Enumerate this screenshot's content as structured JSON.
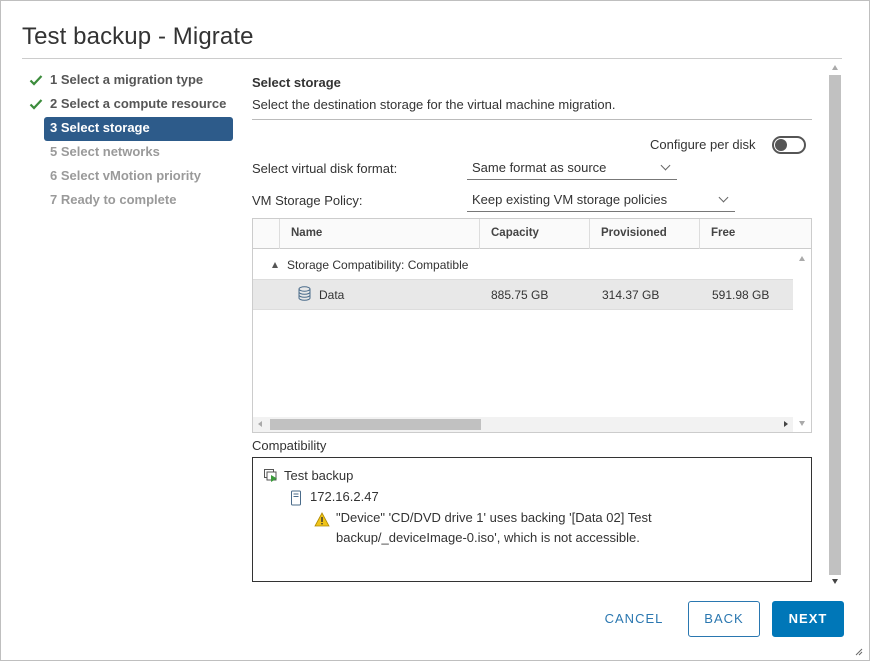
{
  "dialog": {
    "title": "Test backup - Migrate"
  },
  "steps": [
    {
      "label": "1 Select a migration type",
      "state": "done"
    },
    {
      "label": "2 Select a compute resource",
      "state": "done"
    },
    {
      "label": "3 Select storage",
      "state": "active"
    },
    {
      "label": "5 Select networks",
      "state": "disabled"
    },
    {
      "label": "6 Select vMotion priority",
      "state": "disabled"
    },
    {
      "label": "7 Ready to complete",
      "state": "disabled"
    }
  ],
  "section": {
    "title": "Select storage",
    "description": "Select the destination storage for the virtual machine migration."
  },
  "config_per_disk": {
    "label": "Configure per disk",
    "enabled": false
  },
  "disk_format": {
    "label": "Select virtual disk format:",
    "value": "Same format as source"
  },
  "storage_policy": {
    "label": "VM Storage Policy:",
    "value": "Keep existing VM storage policies"
  },
  "grid": {
    "columns": [
      "Name",
      "Capacity",
      "Provisioned",
      "Free"
    ],
    "group_label": "Storage Compatibility: Compatible",
    "rows": [
      {
        "name": "Data",
        "capacity": "885.75 GB",
        "provisioned": "314.37 GB",
        "free": "591.98 GB"
      }
    ]
  },
  "compatibility": {
    "title": "Compatibility",
    "vm_name": "Test backup",
    "host": "172.16.2.47",
    "warning_line1": "\"Device\" 'CD/DVD drive 1' uses backing '[Data 02] Test",
    "warning_line2": "backup/_deviceImage-0.iso', which is not accessible."
  },
  "buttons": {
    "cancel": "CANCEL",
    "back": "BACK",
    "next": "NEXT"
  },
  "colors": {
    "active_step_bg": "#2d5b8a",
    "primary": "#0077b8",
    "link": "#2a77b0",
    "check": "#3c8c3c",
    "warning": "#f0c419"
  }
}
